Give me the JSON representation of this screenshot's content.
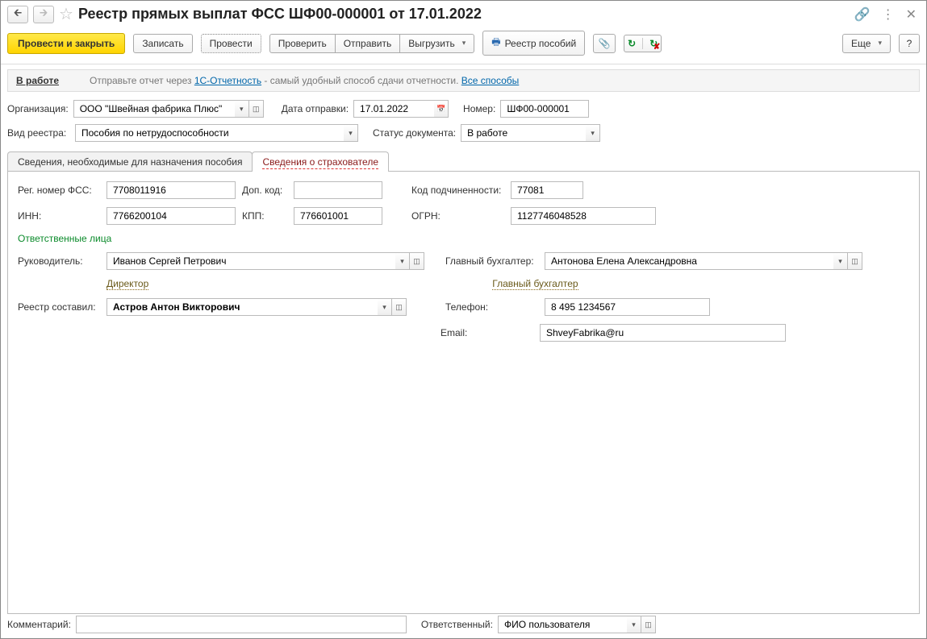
{
  "header": {
    "title": "Реестр прямых выплат ФСС ШФ00-000001 от 17.01.2022"
  },
  "toolbar": {
    "post_close": "Провести и закрыть",
    "save": "Записать",
    "post": "Провести",
    "check": "Проверить",
    "send": "Отправить",
    "export": "Выгрузить",
    "registry": "Реестр пособий",
    "more": "Еще",
    "help": "?"
  },
  "status": {
    "label": "В работе",
    "text1": "Отправьте отчет через ",
    "link1": "1С-Отчетность",
    "text2": " - самый удобный способ сдачи отчетности. ",
    "link2": "Все способы"
  },
  "org_row": {
    "org_label": "Организация:",
    "org_value": "ООО \"Швейная фабрика Плюс\"",
    "date_label": "Дата отправки:",
    "date_value": "17.01.2022",
    "number_label": "Номер:",
    "number_value": "ШФ00-000001"
  },
  "type_row": {
    "type_label": "Вид реестра:",
    "type_value": "Пособия по нетрудоспособности",
    "status_label": "Статус документа:",
    "status_value": "В работе"
  },
  "tabs": {
    "t1": "Сведения, необходимые для назначения пособия",
    "t2": "Сведения о страхователе"
  },
  "insurer": {
    "reg_label": "Рег. номер ФСС:",
    "reg_value": "7708011916",
    "add_label": "Доп. код:",
    "add_value": "",
    "sub_label": "Код подчиненности:",
    "sub_value": "77081",
    "inn_label": "ИНН:",
    "inn_value": "7766200104",
    "kpp_label": "КПП:",
    "kpp_value": "776601001",
    "ogrn_label": "ОГРН:",
    "ogrn_value": "1127746048528",
    "section": "Ответственные лица",
    "head_label": "Руководитель:",
    "head_value": "Иванов Сергей Петрович",
    "head_pos": "Директор",
    "acc_label": "Главный бухгалтер:",
    "acc_value": "Антонова Елена Александровна",
    "acc_pos": "Главный бухгалтер",
    "author_label": "Реестр составил:",
    "author_value": "Астров Антон Викторович",
    "phone_label": "Телефон:",
    "phone_value": "8 495 1234567",
    "email_label": "Email:",
    "email_value": "ShveyFabrika@ru"
  },
  "footer": {
    "comment_label": "Комментарий:",
    "comment_value": "",
    "resp_label": "Ответственный:",
    "resp_value": "ФИО пользователя"
  }
}
